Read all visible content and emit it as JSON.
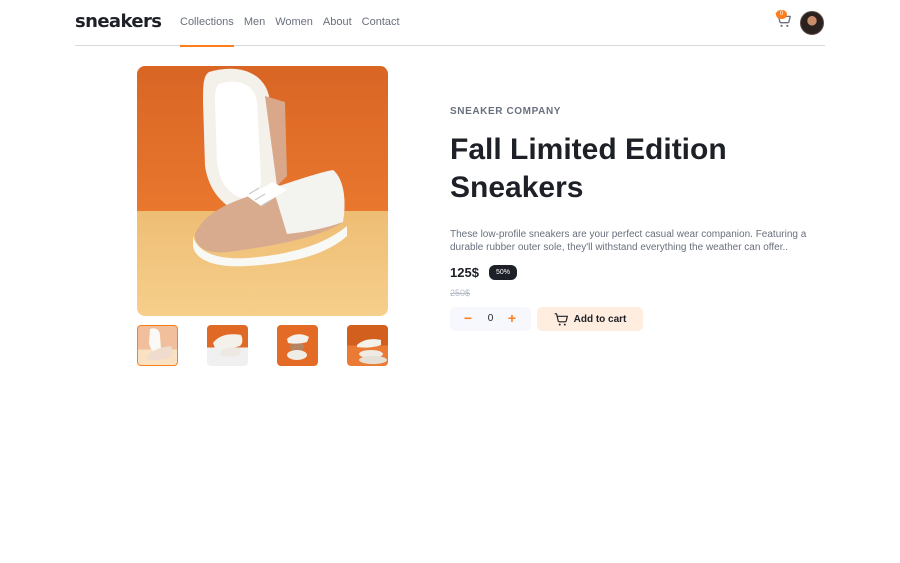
{
  "header": {
    "logo": "sneakers",
    "nav": [
      {
        "label": "Collections",
        "active": true
      },
      {
        "label": "Men",
        "active": false
      },
      {
        "label": "Women",
        "active": false
      },
      {
        "label": "About",
        "active": false
      },
      {
        "label": "Contact",
        "active": false
      }
    ],
    "cart": {
      "icon": "cart-icon",
      "badge_count": "0"
    },
    "avatar": {
      "icon": "user-avatar"
    }
  },
  "gallery": {
    "main_image": "sneaker-main-photo",
    "thumbnails": [
      "thumbnail-1",
      "thumbnail-2",
      "thumbnail-3",
      "thumbnail-4"
    ],
    "selected_thumbnail": 1
  },
  "product": {
    "company": "SNEAKER COMPANY",
    "title": "Fall Limited Edition Sneakers",
    "description": "These low-profile sneakers are your perfect casual wear companion. Featuring a durable rubber outer sole, they'll withstand everything the weather can offer..",
    "price": "125$",
    "discount": "50%",
    "old_price": "250$",
    "quantity": "0",
    "minus_label": "−",
    "plus_label": "+",
    "add_to_cart_label": "Add to cart"
  },
  "colors": {
    "accent": "#ff7e1b",
    "dark": "#1d2026",
    "muted": "#69707d",
    "light_accent": "#ffede0"
  }
}
